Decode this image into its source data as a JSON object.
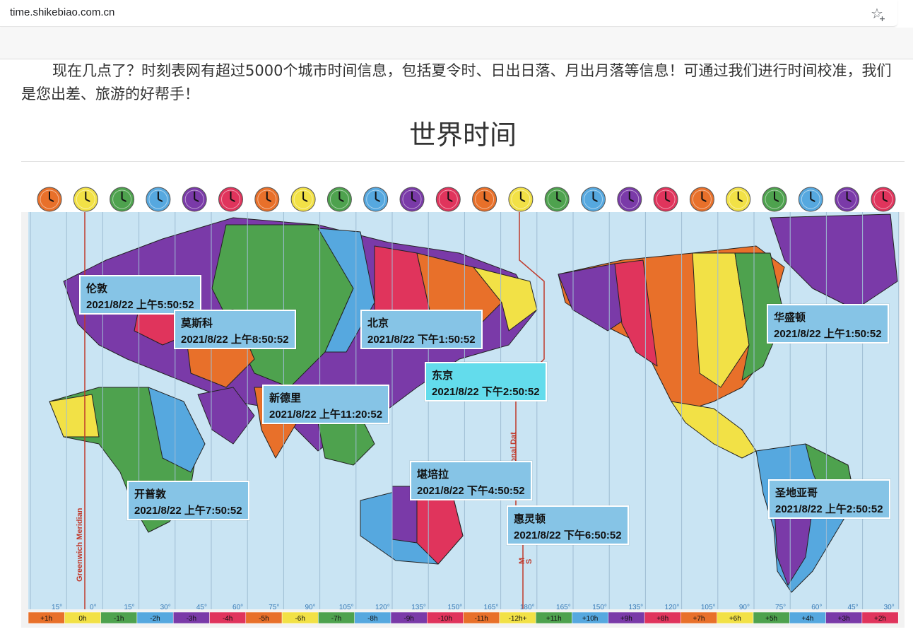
{
  "browser": {
    "url": "time.shikebiao.com.cn",
    "bookmark_icon": "star-add-icon"
  },
  "intro": "现在几点了？时刻表网有超过5000个城市时间信息，包括夏令时、日出日落、月出月落等信息！可通过我们进行时间校准，我们是您出差、旅游的好帮手！",
  "title": "世界时间",
  "map": {
    "meridian_label": "Greenwich Meridian",
    "dateline_label": "International Dat",
    "dateline_marks": [
      "M",
      "S"
    ],
    "degrees": [
      "15°",
      "0°",
      "15°",
      "30°",
      "45°",
      "60°",
      "75°",
      "90°",
      "105°",
      "120°",
      "135°",
      "150°",
      "165°",
      "180°",
      "165°",
      "150°",
      "135°",
      "120°",
      "105°",
      "90°",
      "75°",
      "60°",
      "45°",
      "30°"
    ],
    "offsets": [
      "+1h",
      "0h",
      "-1h",
      "-2h",
      "-3h",
      "-4h",
      "-5h",
      "-6h",
      "-7h",
      "-8h",
      "-9h",
      "-10h",
      "-11h",
      "-12h+",
      "+11h",
      "+10h",
      "+9h",
      "+8h",
      "+7h",
      "+6h",
      "+5h",
      "+4h",
      "+3h",
      "+2h"
    ],
    "colors": [
      "#e8702a",
      "#f2e146",
      "#4ea24e",
      "#56a8df",
      "#7a3aa8",
      "#e0345c"
    ]
  },
  "cities": [
    {
      "name": "伦敦",
      "time": "2021/8/22 上午5:50:52"
    },
    {
      "name": "莫斯科",
      "time": "2021/8/22 上午8:50:52"
    },
    {
      "name": "北京",
      "time": "2021/8/22 下午1:50:52"
    },
    {
      "name": "华盛顿",
      "time": "2021/8/22 上午1:50:52"
    },
    {
      "name": "东京",
      "time": "2021/8/22 下午2:50:52"
    },
    {
      "name": "新德里",
      "time": "2021/8/22 上午11:20:52"
    },
    {
      "name": "堪培拉",
      "time": "2021/8/22 下午4:50:52"
    },
    {
      "name": "开普敦",
      "time": "2021/8/22 上午7:50:52"
    },
    {
      "name": "圣地亚哥",
      "time": "2021/8/22 上午2:50:52"
    },
    {
      "name": "惠灵顿",
      "time": "2021/8/22 下午6:50:52"
    }
  ]
}
